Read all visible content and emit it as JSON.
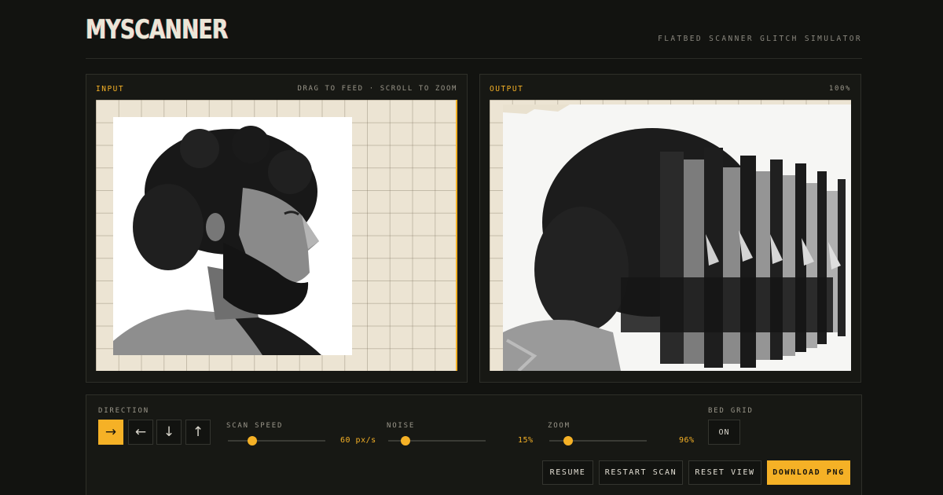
{
  "app": {
    "title": "MYSCANNER",
    "subtitle": "FLATBED SCANNER GLITCH SIMULATOR"
  },
  "input_panel": {
    "label": "INPUT",
    "hint": "DRAG TO FEED · SCROLL TO ZOOM"
  },
  "output_panel": {
    "label": "OUTPUT",
    "zoom_readout": "100%"
  },
  "controls": {
    "direction": {
      "label": "DIRECTION",
      "options": [
        {
          "glyph": "→",
          "active": true
        },
        {
          "glyph": "←",
          "active": false
        },
        {
          "glyph": "↓",
          "active": false
        },
        {
          "glyph": "↑",
          "active": false
        }
      ]
    },
    "scan_speed": {
      "label": "SCAN SPEED",
      "value": "60 px/s",
      "fraction": 0.25
    },
    "noise": {
      "label": "NOISE",
      "value": "15%",
      "fraction": 0.18
    },
    "zoom": {
      "label": "ZOOM",
      "value": "96%",
      "fraction": 0.19
    },
    "bed_grid": {
      "label": "BED GRID",
      "value": "ON"
    },
    "buttons": {
      "resume": "RESUME",
      "restart": "RESTART SCAN",
      "reset": "RESET VIEW",
      "download": "DOWNLOAD PNG"
    }
  },
  "colors": {
    "accent": "#f5b126",
    "background": "#121310",
    "bed": "#ece4d3"
  }
}
